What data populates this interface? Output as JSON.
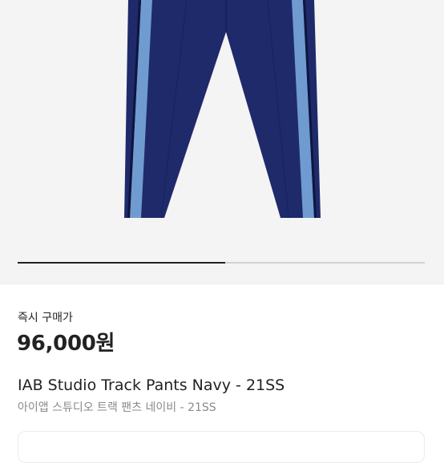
{
  "product": {
    "image_alt": "IAB Studio Track Pants Navy",
    "gallery_progress": 0.51,
    "price_label": "즉시 구매가",
    "price": "96,000원",
    "title_en": "IAB Studio Track Pants Navy - 21SS",
    "title_ko": "아이앱 스튜디오 트랙 팬츠 네이비 - 21SS"
  },
  "colors": {
    "navy": "#1f2a6b",
    "stripe": "#6f9bd0",
    "background": "#f4f4f4"
  }
}
